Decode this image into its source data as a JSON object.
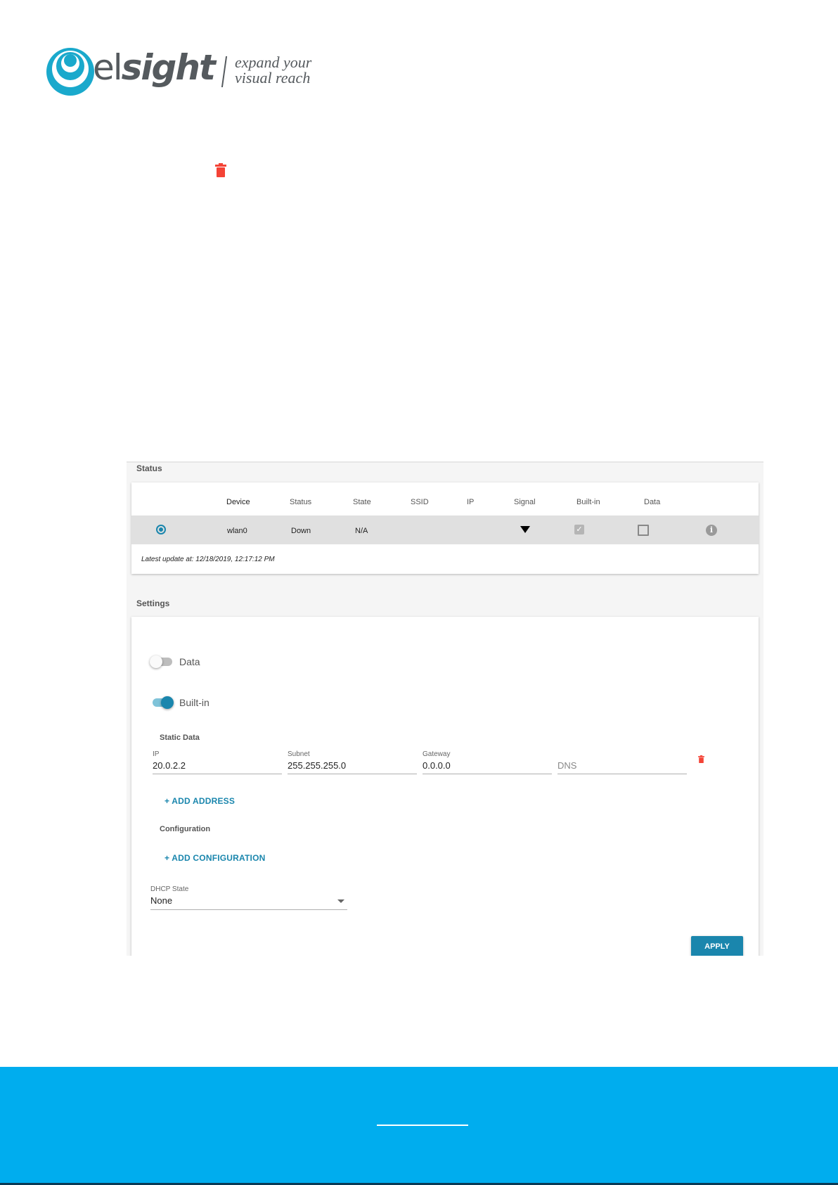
{
  "logo": {
    "brand_prefix": "el",
    "brand_bold": "sight",
    "tagline_line1": "expand your",
    "tagline_line2": "visual reach"
  },
  "icons": {
    "top_trash": "trash-icon",
    "field_trash": "trash-icon",
    "signal": "wifi-signal-icon",
    "info": "info-icon",
    "dropdown": "caret-down-icon"
  },
  "colors": {
    "accent": "#1a86ad",
    "trash": "#f44336",
    "footer": "#00adee"
  },
  "status": {
    "section_title": "Status",
    "columns": [
      "Device",
      "Status",
      "State",
      "SSID",
      "IP",
      "Signal",
      "Built-in",
      "Data"
    ],
    "row": {
      "selected": true,
      "device": "wlan0",
      "status": "Down",
      "state": "N/A",
      "ssid": "",
      "ip": "",
      "built_in": true,
      "data": false
    },
    "latest_update": "Latest update at: 12/18/2019, 12:17:12 PM"
  },
  "settings": {
    "section_title": "Settings",
    "data_toggle": {
      "label": "Data",
      "on": false
    },
    "builtin_toggle": {
      "label": "Built-in",
      "on": true
    },
    "static_data_title": "Static Data",
    "fields": {
      "ip": {
        "label": "IP",
        "value": "20.0.2.2"
      },
      "subnet": {
        "label": "Subnet",
        "value": "255.255.255.0"
      },
      "gateway": {
        "label": "Gateway",
        "value": "0.0.0.0"
      },
      "dns": {
        "label": "",
        "placeholder": "DNS"
      }
    },
    "add_address": "+ ADD ADDRESS",
    "configuration_title": "Configuration",
    "add_configuration": "+ ADD CONFIGURATION",
    "dhcp": {
      "label": "DHCP State",
      "value": "None"
    },
    "apply": "APPLY"
  }
}
